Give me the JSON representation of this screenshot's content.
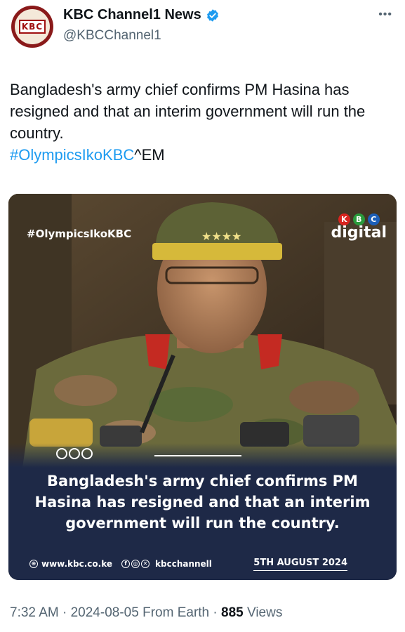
{
  "account": {
    "display_name": "KBC Channel1 News",
    "handle": "@KBCChannel1",
    "avatar_logo": "KBC",
    "verified": true
  },
  "tweet": {
    "text": "Bangladesh's army chief confirms PM Hasina has resigned and that an interim government will run the country.",
    "hashtag": "#OlympicsIkoKBC",
    "suffix": "^EM"
  },
  "media": {
    "overlay_hashtag": "#OlympicsIkoKBC",
    "brand_letters": [
      "K",
      "B",
      "C"
    ],
    "brand_word": "digital",
    "headline": "Bangladesh's army chief confirms PM Hasina has resigned and that an interim government will run the country.",
    "website": "www.kbc.co.ke",
    "social_handle": "kbcchannell",
    "date": "5TH AUGUST 2024"
  },
  "meta": {
    "time": "7:32 AM",
    "date": "2024-08-05",
    "source": "From Earth",
    "views_count": "885",
    "views_label": "Views"
  },
  "colors": {
    "link": "#1d9bf0",
    "verified": "#1d9bf0",
    "caption_bg": "#1e2947",
    "muted_text": "#536471"
  }
}
